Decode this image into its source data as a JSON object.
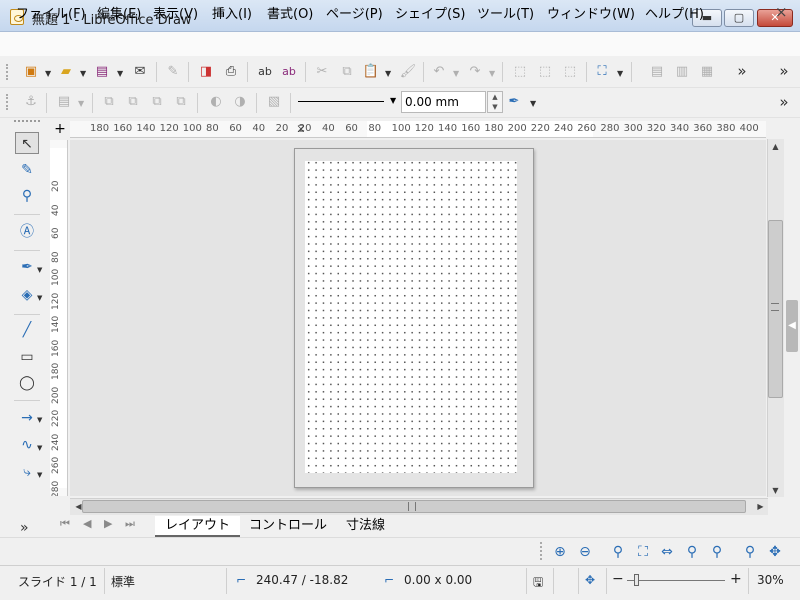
{
  "window": {
    "title": "無題 1 - LibreOffice Draw",
    "controls": {
      "minimize": "▬",
      "maximize": "▢",
      "close": "✕"
    }
  },
  "menu": {
    "items": [
      "ファイル(F)",
      "編集(E)",
      "表示(V)",
      "挿入(I)",
      "書式(O)",
      "ページ(P)",
      "シェイプ(S)",
      "ツール(T)",
      "ウィンドウ(W)",
      "ヘルプ(H)"
    ],
    "close_doc": "×"
  },
  "toolbar_standard": {
    "overflow": "»",
    "icons": [
      "new-doc-icon",
      "open-folder-icon",
      "save-icon",
      "email-icon",
      "edit-doc-icon",
      "export-pdf-icon",
      "print-icon",
      "spellcheck-icon",
      "autospell-icon",
      "cut-icon",
      "copy-icon",
      "paste-icon",
      "clone-format-icon",
      "undo-icon",
      "redo-icon",
      "crop-icon",
      "transform-icon",
      "image-icon",
      "zoom-pan-icon",
      "align-icon",
      "distribute-icon",
      "arrange-icon"
    ]
  },
  "toolbar_line": {
    "width_value": "0.00 mm",
    "overflow": "»"
  },
  "ruler": {
    "corner": "+",
    "horizontal_ticks": [
      "180",
      "160",
      "140",
      "120",
      "100",
      "80",
      "60",
      "40",
      "20",
      "20",
      "40",
      "60",
      "80",
      "100",
      "120",
      "140",
      "160",
      "180",
      "200",
      "220",
      "240",
      "260",
      "280",
      "300",
      "320",
      "340",
      "360",
      "380",
      "400"
    ],
    "vertical_ticks": [
      "20",
      "40",
      "60",
      "80",
      "100",
      "120",
      "140",
      "160",
      "180",
      "200",
      "220",
      "240",
      "260",
      "280"
    ]
  },
  "tabs": {
    "items": [
      "レイアウト",
      "コントロール",
      "寸法線"
    ],
    "active_index": 0,
    "more": "»"
  },
  "status": {
    "slide": "スライド 1 / 1",
    "layout": "標準",
    "position": "240.47 / -18.82",
    "size": "0.00 x 0.00",
    "zoom": "30%",
    "zoom_level": 0.3
  },
  "colors": {
    "accent": "#2a6db5",
    "close_button": "#c44a3a",
    "titlebar": "#c5d7ee"
  }
}
